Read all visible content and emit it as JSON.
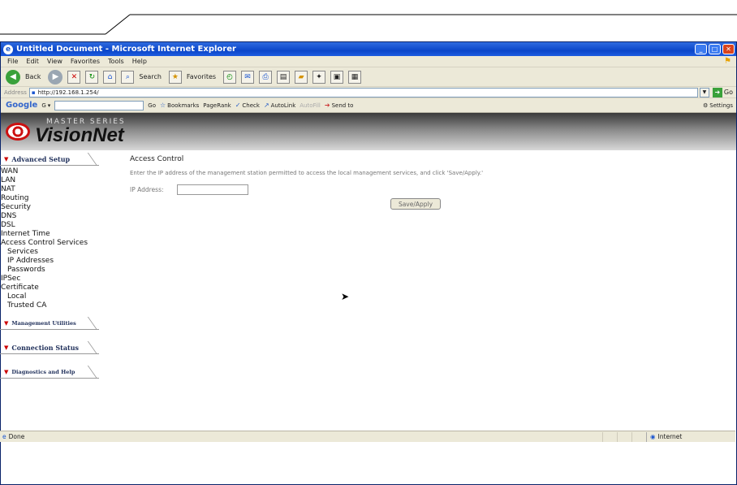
{
  "window": {
    "title": "Untitled Document - Microsoft Internet Explorer"
  },
  "menu": [
    "File",
    "Edit",
    "View",
    "Favorites",
    "Tools",
    "Help"
  ],
  "toolbar": {
    "back": "Back",
    "search": "Search",
    "favorites": "Favorites"
  },
  "address": {
    "label": "Address",
    "url": "http://192.168.1.254/",
    "go": "Go"
  },
  "google": {
    "logo": "Google",
    "g_label": "G",
    "go": "Go",
    "bookmarks": "Bookmarks",
    "pagerank": "PageRank",
    "check": "Check",
    "autolink": "AutoLink",
    "autofill": "AutoFill",
    "sendto": "Send to",
    "settings": "Settings"
  },
  "brand": {
    "series": "MASTER SERIES",
    "name": "VisionNet"
  },
  "sidebar": {
    "advanced_setup": "Advanced Setup",
    "items": [
      "WAN",
      "LAN",
      "NAT",
      "Routing",
      "Security",
      "DNS",
      "DSL",
      "Internet Time",
      "Access Control Services"
    ],
    "access_sub": [
      "Services",
      "IP Addresses",
      "Passwords"
    ],
    "items2": [
      "IPSec",
      "Certificate"
    ],
    "cert_sub": [
      "Local",
      "Trusted CA"
    ],
    "management": "Management Utilities",
    "connection": "Connection Status",
    "diagnostics": "Diagnostics and Help"
  },
  "main": {
    "title": "Access Control",
    "description": "Enter the IP address of the management station permitted to access the local management services, and click 'Save/Apply.'",
    "ip_label": "IP Address:",
    "ip_value": "",
    "save_label": "Save/Apply"
  },
  "status": {
    "text": "Done",
    "zone": "Internet"
  }
}
